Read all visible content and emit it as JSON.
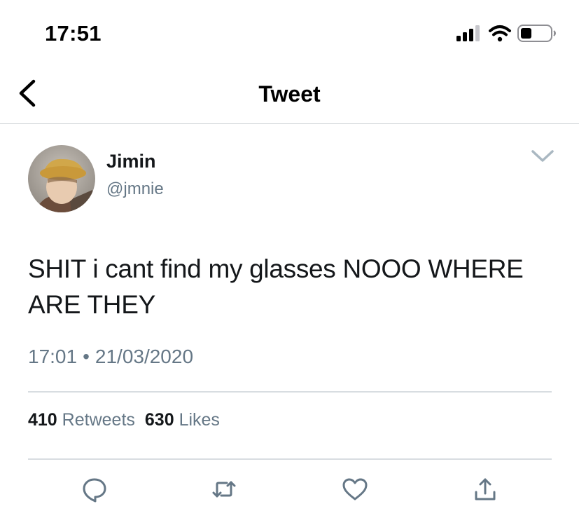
{
  "status_bar": {
    "time": "17:51",
    "icons": [
      "cellular-signal-icon",
      "wifi-icon",
      "battery-icon"
    ]
  },
  "nav": {
    "title": "Tweet",
    "back_icon": "chevron-left-icon"
  },
  "tweet": {
    "author": {
      "display_name": "Jimin",
      "handle": "@jmnie"
    },
    "text": "SHIT i cant find my glasses NOOO WHERE ARE THEY",
    "time": "17:01",
    "separator": "•",
    "date": "21/03/2020",
    "stats": {
      "retweets_count": "410",
      "retweets_label": "Retweets",
      "likes_count": "630",
      "likes_label": "Likes"
    },
    "actions": [
      "reply-icon",
      "retweet-icon",
      "like-icon",
      "share-icon"
    ]
  },
  "colors": {
    "text_primary": "#14171a",
    "text_secondary": "#657786",
    "divider": "#d8dde1",
    "icon_gray": "#657786"
  }
}
